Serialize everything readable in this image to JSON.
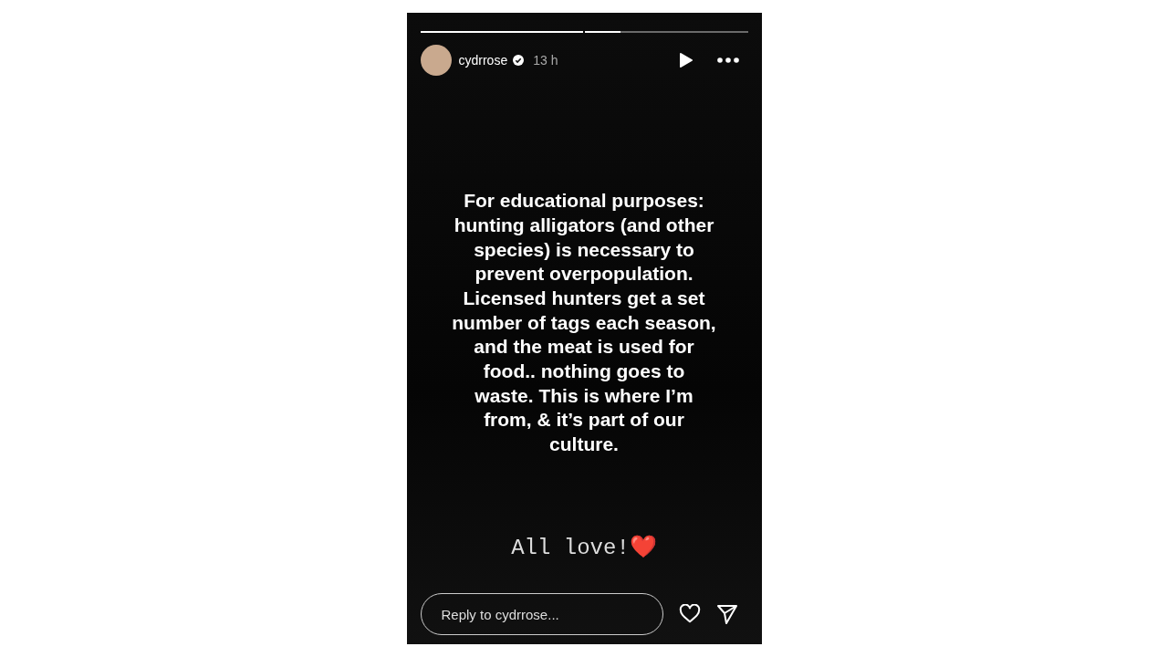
{
  "progress": [
    {
      "level": 1
    },
    {
      "level": 0.22
    }
  ],
  "header": {
    "username": "cydrrose",
    "verified": true,
    "time": "13 h"
  },
  "story": {
    "text": "For educational purposes: hunting alligators (and other species) is necessary to prevent overpopulation. Licensed hunters get a set number of tags each season, and the meat is used for food.. nothing goes to waste. This is where I’m from, & it’s part of our culture.",
    "signoff": "All love!❤️"
  },
  "reply": {
    "placeholder": "Reply to cydrrose..."
  }
}
